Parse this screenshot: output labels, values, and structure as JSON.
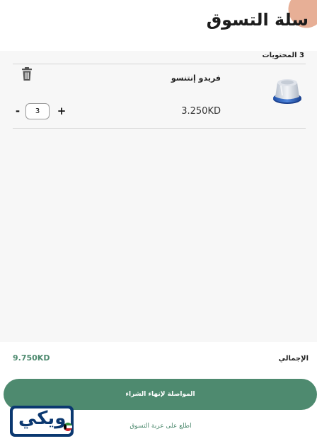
{
  "header": {
    "title": "سلة التسوق"
  },
  "cart": {
    "count_label": "3 المحتويات",
    "items": [
      {
        "name": "فريدو إنتنسو",
        "price": "3.250KD",
        "quantity": "3"
      }
    ],
    "minus_label": "-",
    "plus_label": "+",
    "icons": {
      "delete": "trash-icon",
      "product": "coffee-capsule-image"
    }
  },
  "footer": {
    "total_label": "الإجمالي",
    "total_value": "9.750KD",
    "checkout_label": "المواصلة لإنهاء الشراء",
    "view_cart_label": "اطلع على عربة التسوق"
  },
  "watermark": {
    "text": "ويكي",
    "brand_color": "#0b3870"
  },
  "colors": {
    "accent": "#4e8a6f"
  }
}
